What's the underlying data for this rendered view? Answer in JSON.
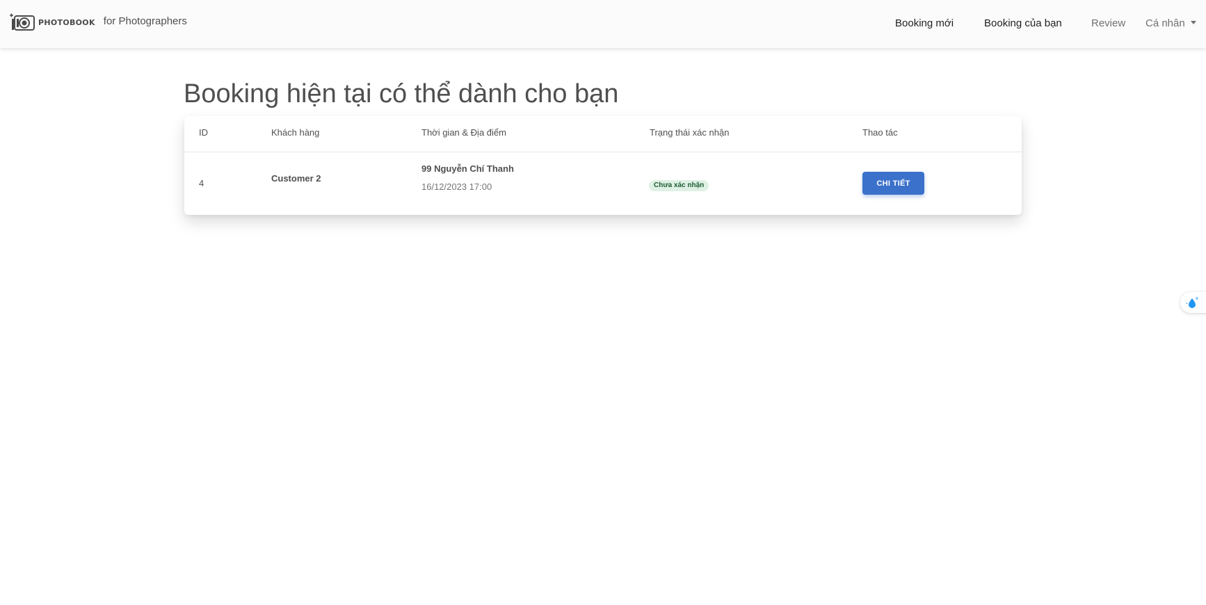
{
  "brand": {
    "logo_text": "PHOTOBOOK",
    "subtitle": "for Photographers"
  },
  "nav": {
    "items": [
      {
        "label": "Booking mới"
      },
      {
        "label": "Booking của bạn"
      },
      {
        "label": "Review"
      },
      {
        "label": "Cá nhân"
      }
    ]
  },
  "page": {
    "title": "Booking hiện tại có thể dành cho bạn"
  },
  "table": {
    "headers": [
      "ID",
      "Khách hàng",
      "Thời gian & Địa điểm",
      "Trạng thái xác nhận",
      "Thao tác"
    ],
    "rows": [
      {
        "id": "4",
        "customer": "Customer 2",
        "location": "99 Nguyễn Chí Thanh",
        "datetime": "16/12/2023 17:00",
        "status": "Chưa xác nhận",
        "action_label": "CHI TIẾT"
      }
    ]
  },
  "colors": {
    "primary": "#3b71ca",
    "status_bg": "#dff1e4",
    "status_text": "#1d5c33",
    "navbar_bg": "#fbfbfb"
  },
  "icons": {
    "logo": "camera-icon",
    "dropdown": "caret-down-icon",
    "widget": "water-drop-sparkle-icon"
  }
}
